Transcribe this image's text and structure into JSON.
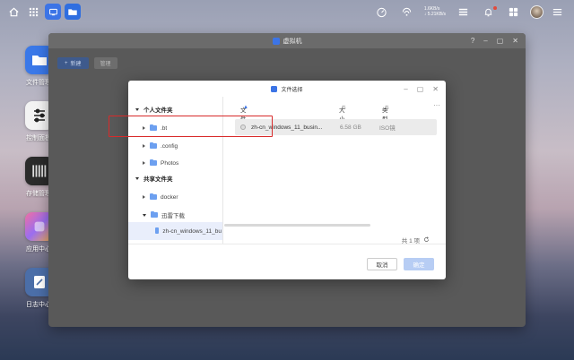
{
  "topbar": {
    "net_up": "1.6KB/s",
    "net_down": "↓ 5.21KB/s"
  },
  "desktop": [
    {
      "label": "文件管理"
    },
    {
      "label": "控制面板"
    },
    {
      "label": "存储管理"
    },
    {
      "label": "应用中心"
    },
    {
      "label": "日志中心"
    }
  ],
  "vm_window": {
    "title": "虚拟机",
    "help": "?",
    "new_label": "新建",
    "manage_label": "管理"
  },
  "dialog": {
    "title": "文件选择",
    "sidebar": {
      "personal_label": "个人文件夹",
      "personal_items": [
        ".bt",
        ".config",
        "Photos"
      ],
      "shared_label": "共享文件夹",
      "shared_items": [
        "docker",
        "迅雷下载"
      ],
      "selected_item": "zh-cn_windows_11_bu"
    },
    "columns": {
      "name": "文件名",
      "size": "大小",
      "type": "类型",
      "more": "···"
    },
    "files": [
      {
        "name": "zh-cn_windows_11_busin...",
        "size": "6.58 GB",
        "type": "ISO镜"
      }
    ],
    "count_text": "共 1 项",
    "cancel_label": "取消",
    "ok_label": "确定"
  },
  "colors": {
    "accent": "#3c74e6",
    "highlight_box": "#d82a2a"
  }
}
